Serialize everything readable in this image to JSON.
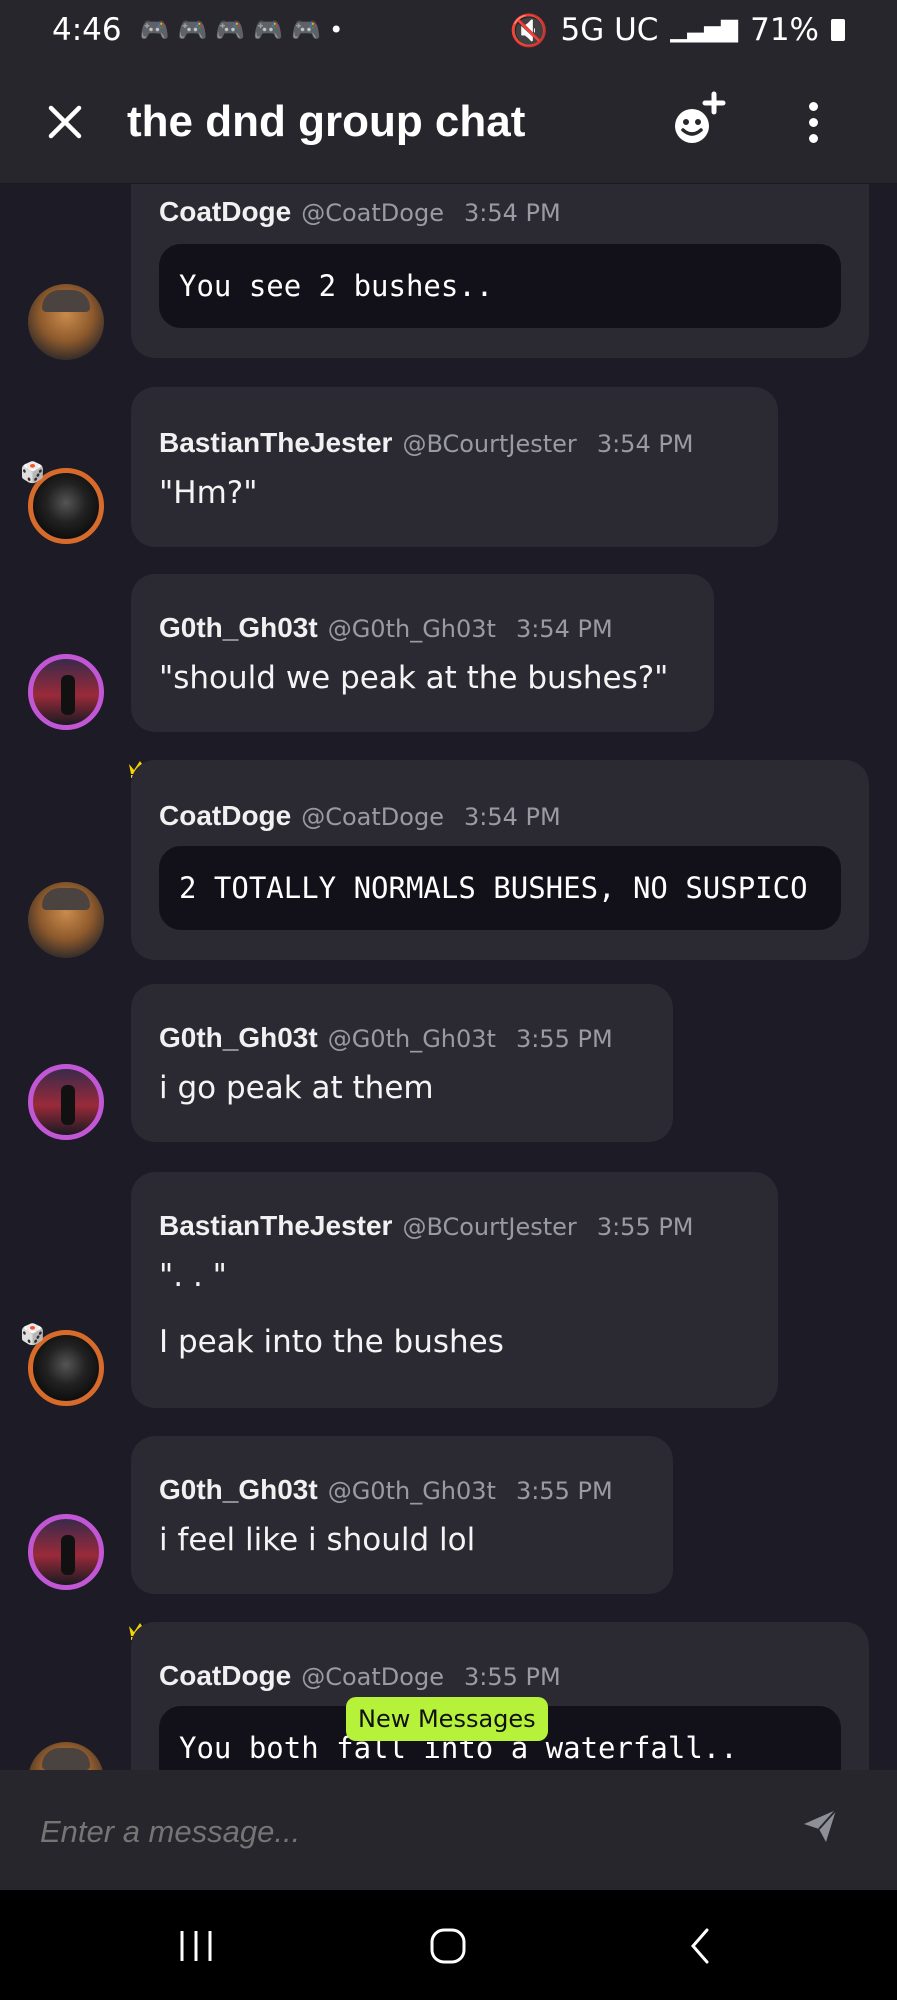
{
  "status_bar": {
    "time": "4:46",
    "notification_icons": [
      "discord-icon",
      "discord-icon",
      "discord-icon",
      "discord-icon",
      "discord-icon"
    ],
    "network": "5G UC",
    "battery": "71%"
  },
  "header": {
    "title": "the dnd group chat"
  },
  "messages": [
    {
      "name": "CoatDoge",
      "handle": "@CoatDoge",
      "time": "3:54 PM",
      "code": "You see 2 bushes.."
    },
    {
      "name": "BastianTheJester",
      "handle": "@BCourtJester",
      "time": "3:54 PM",
      "text": "\"Hm?\""
    },
    {
      "name": "G0th_Gh03t",
      "handle": "@G0th_Gh03t",
      "time": "3:54 PM",
      "text": "\"should we peak at the bushes?\""
    },
    {
      "name": "CoatDoge",
      "handle": "@CoatDoge",
      "time": "3:54 PM",
      "code": "2 TOTALLY NORMALS BUSHES, NO SUSPICO"
    },
    {
      "name": "G0th_Gh03t",
      "handle": "@G0th_Gh03t",
      "time": "3:55 PM",
      "text": "i go peak at them"
    },
    {
      "name": "BastianTheJester",
      "handle": "@BCourtJester",
      "time": "3:55 PM",
      "text": "\". . \"",
      "text2": "I peak into the bushes"
    },
    {
      "name": "G0th_Gh03t",
      "handle": "@G0th_Gh03t",
      "time": "3:55 PM",
      "text": "i feel like i should lol"
    },
    {
      "name": "CoatDoge",
      "handle": "@CoatDoge",
      "time": "3:55 PM",
      "code": "You both fall into a waterfall.."
    }
  ],
  "new_messages_label": "New Messages",
  "composer": {
    "placeholder": "Enter a message..."
  },
  "colors": {
    "background": "#1c1b26",
    "bubble": "#2b2a33",
    "accent_new": "#b7f23a",
    "crown": "#f5d400"
  }
}
